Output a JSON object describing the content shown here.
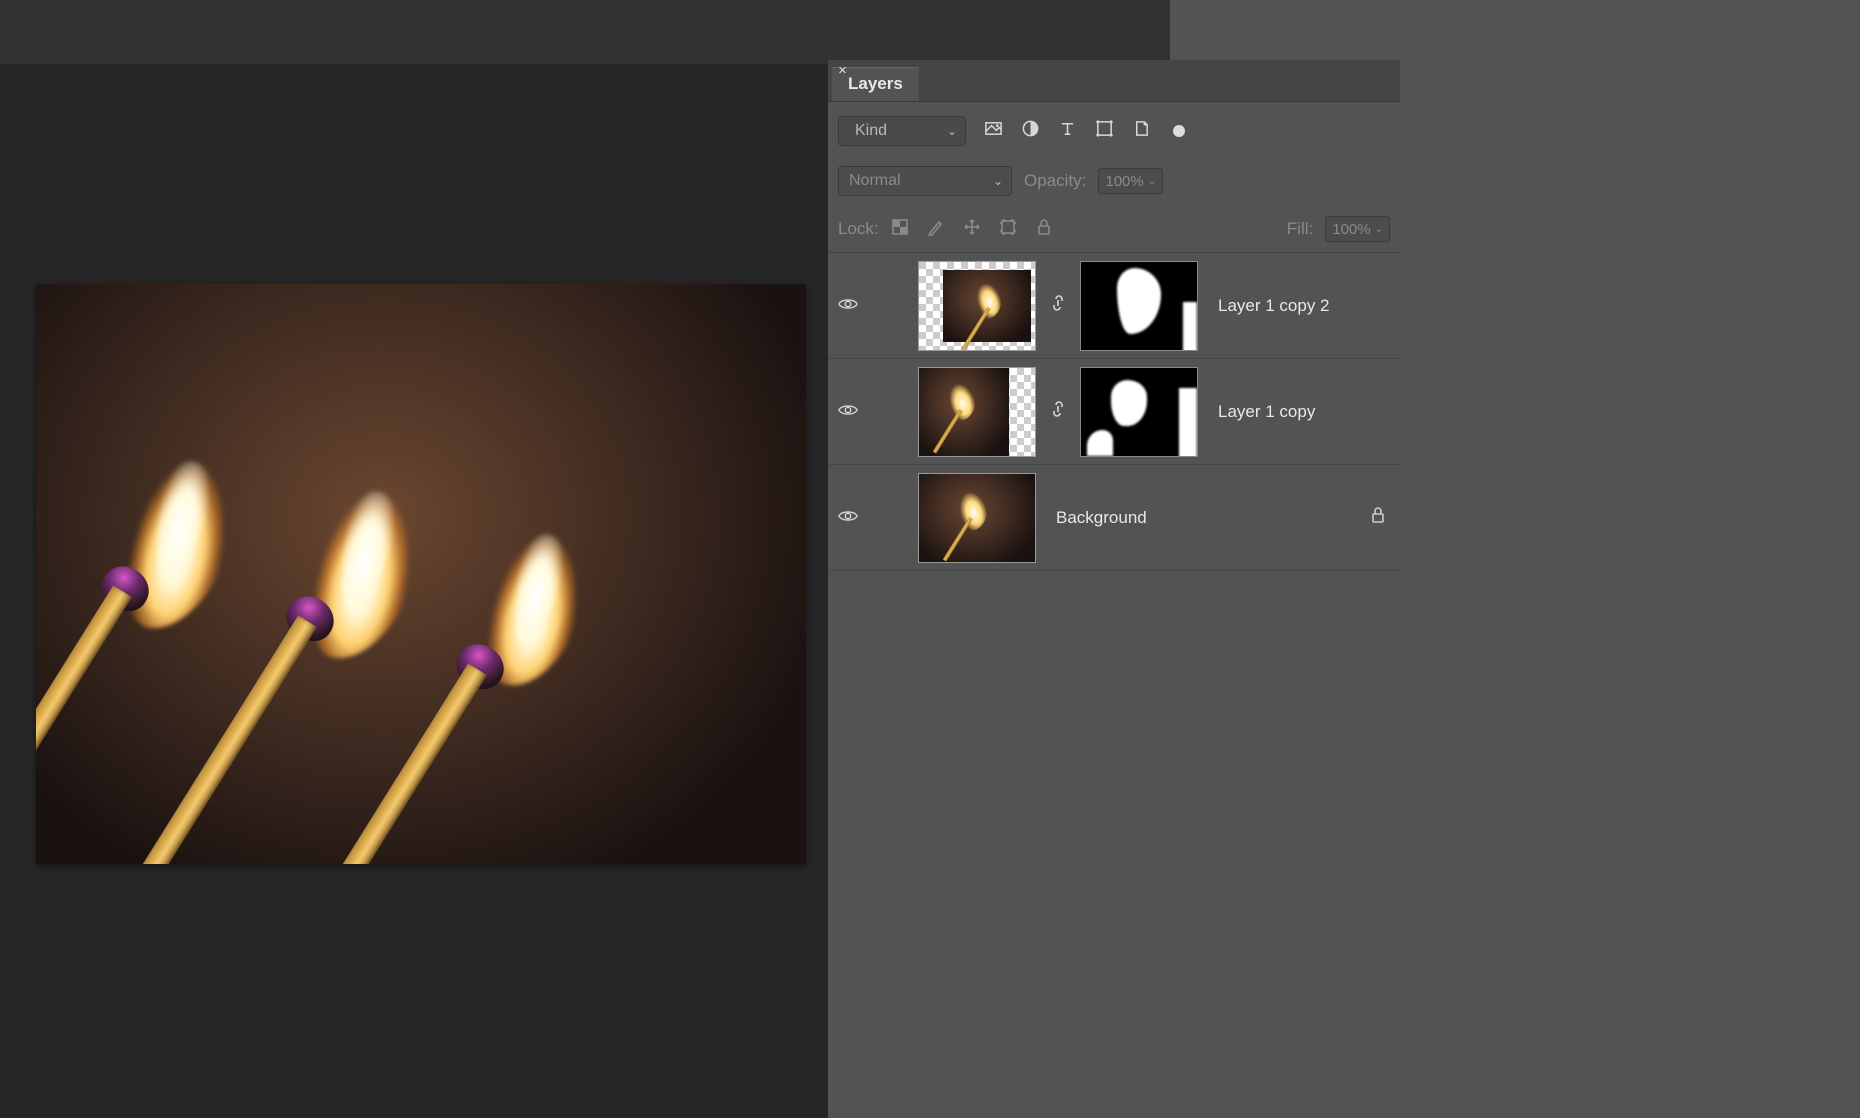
{
  "panel": {
    "tab_label": "Layers",
    "filter": {
      "kind_label": "Kind"
    },
    "blend": {
      "mode_label": "Normal",
      "opacity_label": "Opacity:",
      "opacity_value": "100%"
    },
    "lock": {
      "label": "Lock:",
      "fill_label": "Fill:",
      "fill_value": "100%"
    },
    "layers": [
      {
        "name": "Layer 1 copy 2",
        "visible": true,
        "has_mask": true,
        "locked": false
      },
      {
        "name": "Layer 1 copy",
        "visible": true,
        "has_mask": true,
        "locked": false
      },
      {
        "name": "Background",
        "visible": true,
        "has_mask": false,
        "locked": true
      }
    ]
  }
}
